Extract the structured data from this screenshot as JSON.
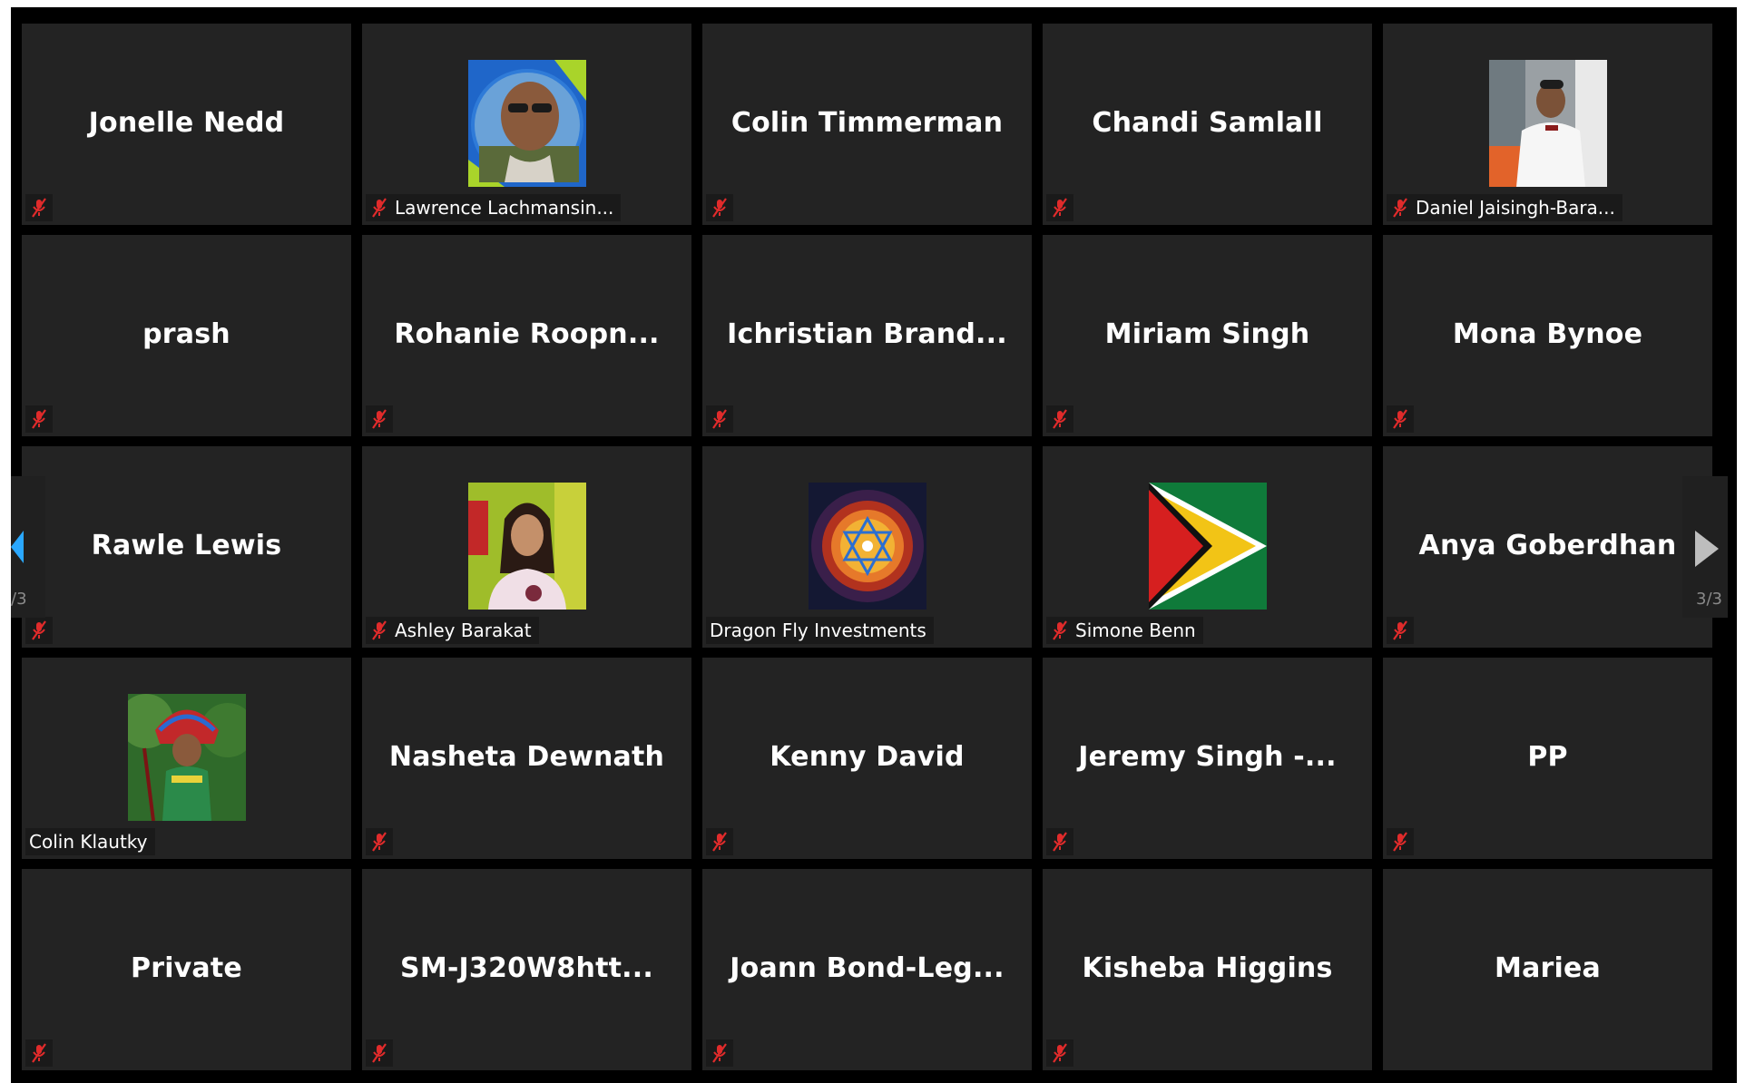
{
  "page": {
    "left": "/3",
    "right": "3/3"
  },
  "colors": {
    "tile": "#232323",
    "mute": "#e02b2b",
    "background": "#000000"
  },
  "participants": [
    {
      "name": "Jonelle Nedd"
    },
    {
      "label": "Lawrence Lachmansin...",
      "avatar": "man-sunglasses-photo"
    },
    {
      "name": "Colin Timmerman"
    },
    {
      "name": "Chandi Samlall"
    },
    {
      "label": "Daniel Jaisingh-Bara...",
      "avatar": "man-bowtie-photo"
    },
    {
      "name": "prash"
    },
    {
      "name": "Rohanie  Roopn..."
    },
    {
      "name": "Ichristian  Brand..."
    },
    {
      "name": "Miriam Singh"
    },
    {
      "name": "Mona Bynoe"
    },
    {
      "name": "Rawle Lewis"
    },
    {
      "label": "Ashley Barakat",
      "avatar": "girl-photo"
    },
    {
      "label": "Dragon Fly Investments",
      "avatar": "mandala-image"
    },
    {
      "label": "Simone Benn",
      "avatar": "guyana-flag-image"
    },
    {
      "name": "Anya Goberdhan"
    },
    {
      "label": "Colin Klautky",
      "avatar": "headdress-photo"
    },
    {
      "name": "Nasheta Dewnath"
    },
    {
      "name": "Kenny David"
    },
    {
      "name": "Jeremy  Singh  -..."
    },
    {
      "name": "PP"
    },
    {
      "name": "Private"
    },
    {
      "name": "SM-J320W8htt..."
    },
    {
      "name": "Joann  Bond-Leg..."
    },
    {
      "name": "Kisheba Higgins"
    },
    {
      "name": "Mariea"
    }
  ]
}
